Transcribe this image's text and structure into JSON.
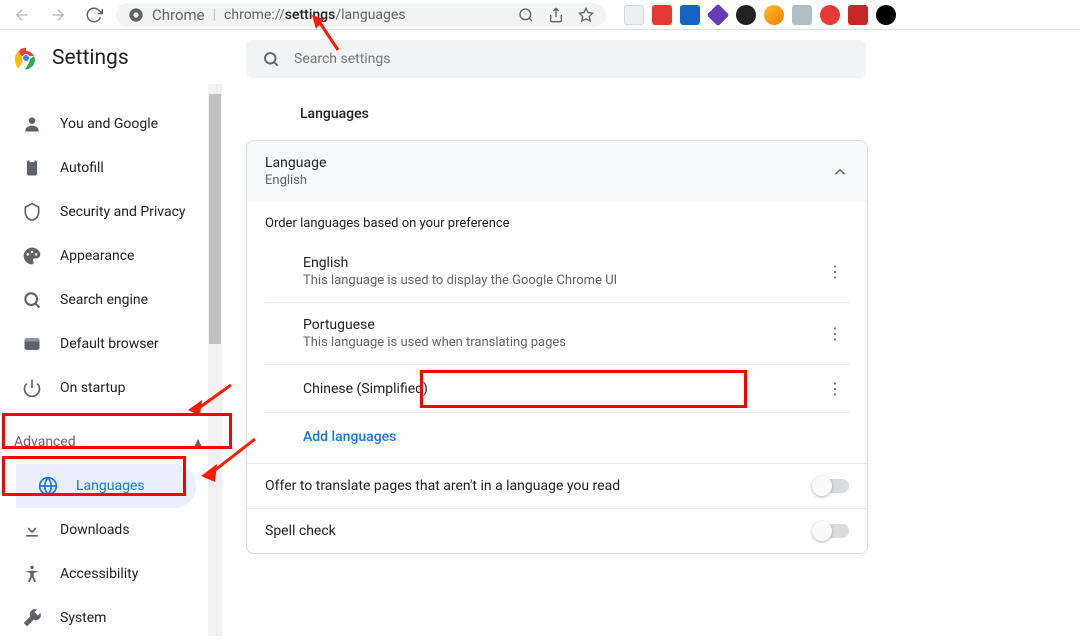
{
  "browser": {
    "chrome_label": "Chrome",
    "url_prefix": "chrome://",
    "url_bold": "settings",
    "url_suffix": "/languages"
  },
  "sidebar": {
    "app_title": "Settings",
    "items": [
      {
        "label": "You and Google"
      },
      {
        "label": "Autofill"
      },
      {
        "label": "Security and Privacy"
      },
      {
        "label": "Appearance"
      },
      {
        "label": "Search engine"
      },
      {
        "label": "Default browser"
      },
      {
        "label": "On startup"
      }
    ],
    "advanced_label": "Advanced",
    "advanced_items": [
      {
        "label": "Languages"
      },
      {
        "label": "Downloads"
      },
      {
        "label": "Accessibility"
      },
      {
        "label": "System"
      }
    ]
  },
  "content": {
    "search_placeholder": "Search settings",
    "section_title": "Languages",
    "language_card": {
      "title": "Language",
      "current": "English",
      "order_hint": "Order languages based on your preference",
      "languages": [
        {
          "name": "English",
          "sub": "This language is used to display the Google Chrome UI"
        },
        {
          "name": "Portuguese",
          "sub": "This language is used when translating pages"
        },
        {
          "name": "Chinese (Simplified)",
          "sub": ""
        }
      ],
      "add_label": "Add languages"
    },
    "translate_option": "Offer to translate pages that aren't in a language you read",
    "spellcheck_option": "Spell check"
  },
  "ext_colors": [
    "#5f6368",
    "#e53935",
    "#1565c0",
    "#673ab7",
    "#212121",
    "#fb8c00",
    "#aab0b6",
    "#e53935",
    "#d32f2f",
    "#212121"
  ]
}
